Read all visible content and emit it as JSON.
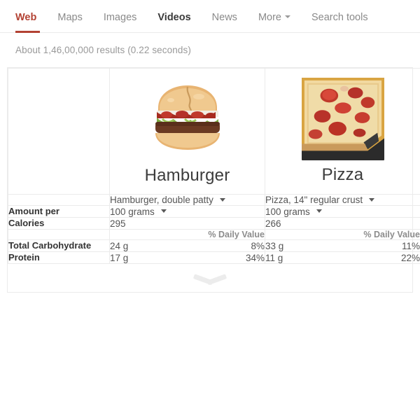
{
  "nav": {
    "tabs": [
      {
        "label": "Web",
        "state": "active"
      },
      {
        "label": "Maps",
        "state": "normal"
      },
      {
        "label": "Images",
        "state": "normal"
      },
      {
        "label": "Videos",
        "state": "strong"
      },
      {
        "label": "News",
        "state": "normal"
      },
      {
        "label": "More",
        "state": "normal",
        "caret": true
      },
      {
        "label": "Search tools",
        "state": "normal"
      }
    ],
    "active_color": "#b34233"
  },
  "result_stats": "About 1,46,00,000 results (0.22 seconds)",
  "comparison": {
    "foods": [
      {
        "title": "Hamburger",
        "image_name": "hamburger-photo",
        "variant": "Hamburger, double patty",
        "amount_per": "100 grams",
        "calories": "295",
        "daily_value_header": "% Daily Value",
        "nutrients": [
          {
            "amount": "24 g",
            "percent": "8%"
          },
          {
            "amount": "17 g",
            "percent": "34%"
          }
        ]
      },
      {
        "title": "Pizza",
        "image_name": "pizza-photo",
        "variant": "Pizza, 14\" regular crust",
        "amount_per": "100 grams",
        "calories": "266",
        "daily_value_header": "% Daily Value",
        "nutrients": [
          {
            "amount": "33 g",
            "percent": "11%"
          },
          {
            "amount": "11 g",
            "percent": "22%"
          }
        ]
      }
    ],
    "row_labels": {
      "amount_per": "Amount per",
      "calories": "Calories",
      "nutrients": [
        "Total Carbohydrate",
        "Protein"
      ]
    }
  },
  "expander": {
    "icon": "chevron-down-icon"
  }
}
